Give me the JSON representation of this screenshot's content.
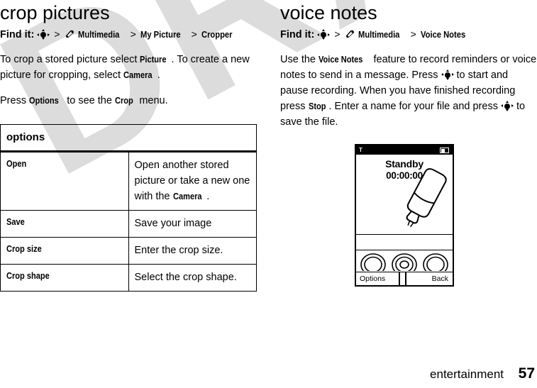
{
  "watermark": {
    "text": "DRAFT",
    "color": "#dcdcdc"
  },
  "left_column": {
    "title": "crop pictures",
    "find_it": {
      "label": "Find it:",
      "nav_icon": "joystick-navigation-key-icon",
      "separator": ">",
      "crumbs": [
        "Multimedia",
        "My Picture",
        "Cropper"
      ],
      "menu_icon": "multimedia-icon"
    },
    "paragraphs": [
      {
        "segments": [
          {
            "text": "To crop a stored picture select ",
            "bold": false
          },
          {
            "text": "Picture",
            "bold": true
          },
          {
            "text": ". To create a new picture for cropping, select ",
            "bold": false
          },
          {
            "text": "Camera",
            "bold": true
          },
          {
            "text": ".",
            "bold": false
          }
        ]
      },
      {
        "segments": [
          {
            "text": "Press ",
            "bold": false
          },
          {
            "text": "Options",
            "bold": true
          },
          {
            "text": " to see the ",
            "bold": false
          },
          {
            "text": "Crop",
            "bold": true
          },
          {
            "text": " menu.",
            "bold": false
          }
        ]
      }
    ],
    "table": {
      "header": "options",
      "rows": [
        {
          "key": "Open",
          "value_pre": "Open another stored picture or take a new one with the ",
          "value_bold": "Camera",
          "value_post": "."
        },
        {
          "key": "Save",
          "value_pre": "Save your image",
          "value_bold": "",
          "value_post": ""
        },
        {
          "key": "Crop size",
          "value_pre": "Enter the crop size.",
          "value_bold": "",
          "value_post": ""
        },
        {
          "key": "Crop shape",
          "value_pre": "Select the crop shape.",
          "value_bold": "",
          "value_post": ""
        }
      ]
    }
  },
  "right_column": {
    "title": "voice notes",
    "find_it": {
      "label": "Find it:",
      "nav_icon": "joystick-navigation-key-icon",
      "separator": ">",
      "crumbs": [
        "Multimedia",
        "Voice Notes"
      ],
      "menu_icon": "multimedia-icon"
    },
    "paragraph": {
      "segments": [
        {
          "text": "Use the ",
          "bold": false
        },
        {
          "text": "Voice Notes",
          "bold": true
        },
        {
          "text": " feature to record reminders or voice notes to send in a message. Press ",
          "bold": false
        },
        {
          "text": "[navkey]",
          "bold": false
        },
        {
          "text": " to start and pause recording. When you have finished recording press ",
          "bold": false
        },
        {
          "text": "Stop",
          "bold": true
        },
        {
          "text": ". Enter a name for your file and press ",
          "bold": false
        },
        {
          "text": "[navkey]",
          "bold": false
        },
        {
          "text": " to save the file.",
          "bold": false
        }
      ]
    },
    "phone": {
      "status_bar": {
        "signal_icon": "signal-strength-icon",
        "signal_glyph": "T",
        "battery_icon": "battery-icon"
      },
      "screen": {
        "title": "Standby",
        "timer": "00:00:00",
        "illustration": "microphone-icon"
      },
      "keys": {
        "left_key_icon": "left-soft-key-icon",
        "center_key_icon": "center-select-key-icon",
        "right_key_icon": "right-soft-key-icon"
      },
      "soft_keys": {
        "left_label": "Options",
        "right_label": "Back"
      }
    }
  },
  "footer": {
    "section": "entertainment",
    "page_number": "57"
  }
}
